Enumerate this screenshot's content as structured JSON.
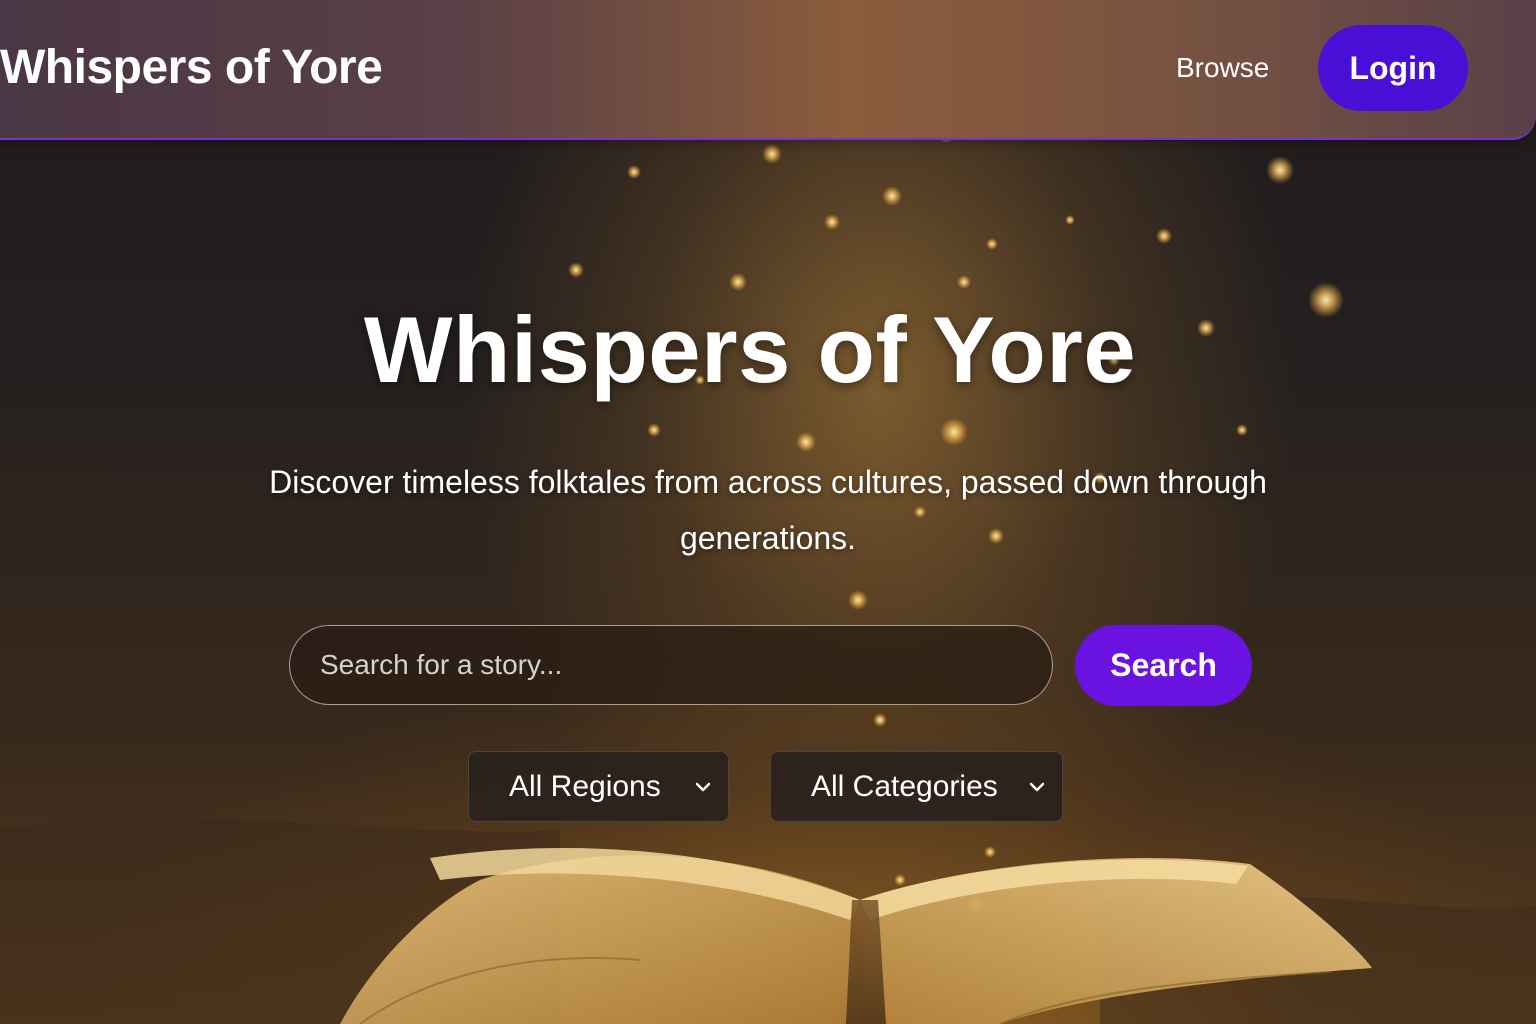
{
  "navbar": {
    "brand": "Whispers of Yore",
    "browse_label": "Browse",
    "login_label": "Login"
  },
  "hero": {
    "title": "Whispers of Yore",
    "subtitle": "Discover timeless folktales from across cultures, passed down through generations."
  },
  "search": {
    "placeholder": "Search for a story...",
    "value": "",
    "button_label": "Search"
  },
  "filters": {
    "region": {
      "selected": "All Regions"
    },
    "category": {
      "selected": "All Categories"
    }
  },
  "icons": {
    "region_dropdown": "chevron-down-icon",
    "category_dropdown": "chevron-down-icon"
  },
  "colors": {
    "login_button": "#4a0fd6",
    "search_button": "#6a12e0",
    "navbar_border": "#7a2fd0",
    "text": "#ffffff",
    "sparkle": "#ffd27a"
  }
}
